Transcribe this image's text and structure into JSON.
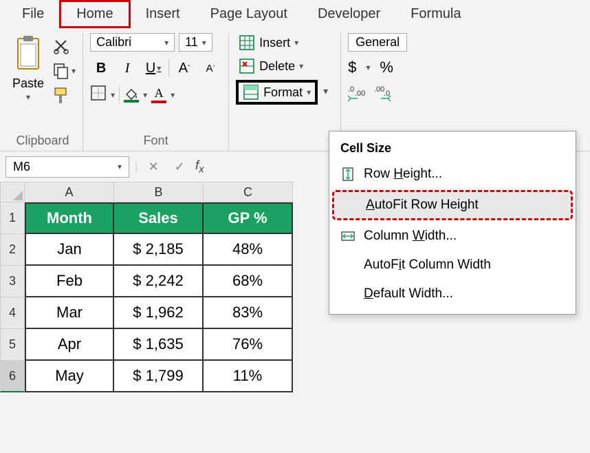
{
  "menubar": {
    "items": [
      "File",
      "Home",
      "Insert",
      "Page Layout",
      "Developer",
      "Formula"
    ]
  },
  "ribbon": {
    "clipboard": {
      "label": "Clipboard",
      "paste": "Paste"
    },
    "font": {
      "label": "Font",
      "name": "Calibri",
      "size": "11",
      "bold": "B",
      "italic": "I",
      "underline": "U"
    },
    "cells": {
      "insert": "Insert",
      "delete": "Delete",
      "format": "Format"
    },
    "number": {
      "format": "General",
      "currency": "$",
      "percent": "%"
    }
  },
  "formulaBar": {
    "cellRef": "M6"
  },
  "grid": {
    "columns": [
      "A",
      "B",
      "C"
    ],
    "rowNumbers": [
      "1",
      "2",
      "3",
      "4",
      "5",
      "6"
    ],
    "headers": [
      "Month",
      "Sales",
      "GP %"
    ],
    "rows": [
      {
        "month": "Jan",
        "sales": "$  2,185",
        "gp": "48%"
      },
      {
        "month": "Feb",
        "sales": "$  2,242",
        "gp": "68%"
      },
      {
        "month": "Mar",
        "sales": "$  1,962",
        "gp": "83%"
      },
      {
        "month": "Apr",
        "sales": "$  1,635",
        "gp": "76%"
      },
      {
        "month": "May",
        "sales": "$  1,799",
        "gp": "11%"
      }
    ]
  },
  "dropdown": {
    "header": "Cell Size",
    "rowHeight": "Row Height...",
    "autofitRow": "AutoFit Row Height",
    "colWidth": "Column Width...",
    "autofitCol": "AutoFit Column Width",
    "defaultWidth": "Default Width..."
  }
}
